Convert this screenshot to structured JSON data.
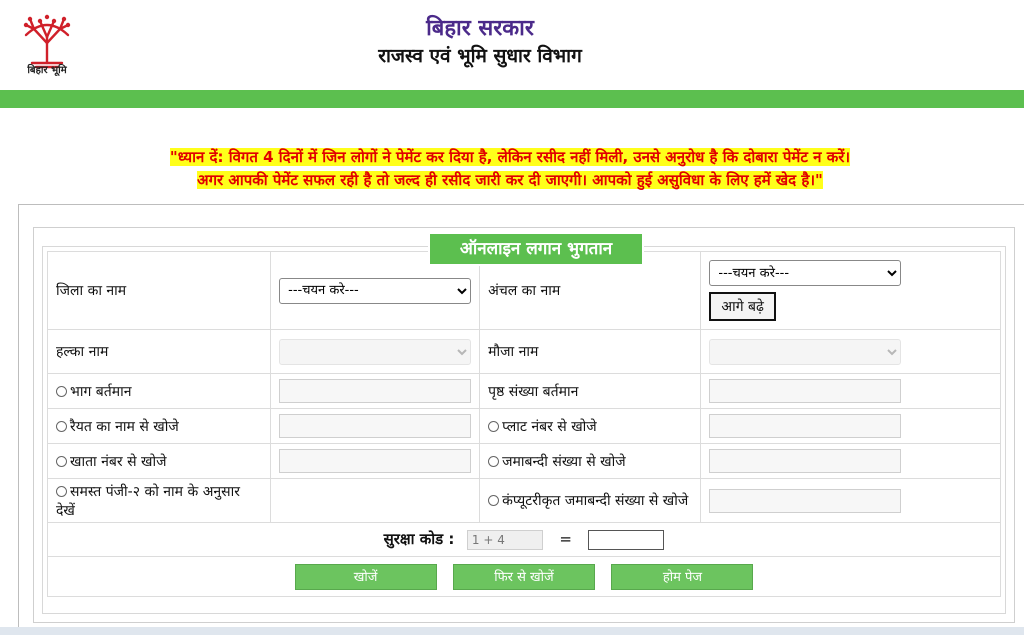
{
  "header": {
    "logo_text": "बिहार भूमि",
    "gov_title": "बिहार सरकार",
    "dept_title": "राजस्व एवं भूमि सुधार विभाग"
  },
  "notice": {
    "line1": "\"ध्यान दें: विगत 4 दिनों में जिन लोगों ने पेमेंट कर दिया है, लेकिन रसीद नहीं मिली, उनसे अनुरोध है कि दोबारा पेमेंट न करें।",
    "line2": "अगर आपकी पेमेंट सफल रही है तो जल्द ही रसीद जारी कर दी जाएगी। आपको हुई असुविधा के लिए हमें खेद है।\""
  },
  "form": {
    "legend": "ऑनलाइन लगान भुगतान",
    "district_label": "जिला का नाम",
    "district_placeholder": "---चयन करे---",
    "circle_label": "अंचल का नाम",
    "circle_placeholder": "---चयन करे---",
    "proceed_button": "आगे बढ़े",
    "halka_label": "हल्का नाम",
    "mauja_label": "मौजा नाम",
    "bhag_label": "भाग बर्तमान",
    "page_no_label": "पृष्ठ संख्या बर्तमान",
    "raiyat_label": "रैयत का नाम से खोजे",
    "plot_label": "प्लाट नंबर से खोजे",
    "khata_label": "खाता नंबर से खोजे",
    "jamabandi_label": "जमाबन्दी संख्या से खोजे",
    "register_label": "समस्त पंजी-२ को नाम के अनुसार देखें",
    "computerized_label": "कंप्यूटरीकृत जमाबन्दी संख्या से खोजे",
    "captcha_label": "सुरक्षा कोड :",
    "captcha_code": "1 + 4",
    "equals": "=",
    "search_button": "खोजें",
    "search_again_button": "फिर से खोजें",
    "home_button": "होम पेज"
  },
  "colors": {
    "brand_green": "#5cbf4f",
    "notice_red": "#e00000",
    "notice_highlight": "#ffff1a",
    "title_purple": "#4b2a8a"
  }
}
